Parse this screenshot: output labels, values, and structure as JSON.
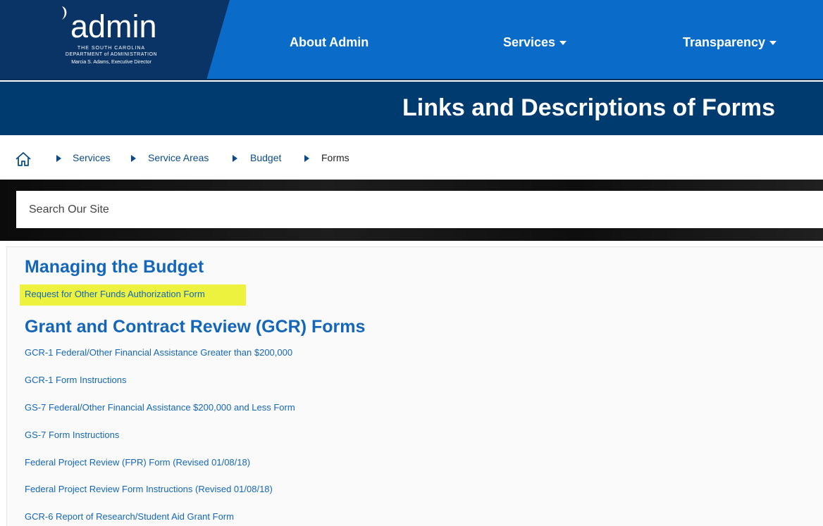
{
  "header": {
    "logo": {
      "word": "admin",
      "line1": "THE SOUTH CAROLINA",
      "line2": "DEPARTMENT of ADMINISTRATION",
      "line3": "Marcia S. Adams, Executive Director"
    },
    "nav": {
      "about": "About Admin",
      "services": "Services",
      "transparency": "Transparency"
    }
  },
  "page_title": "Links and Descriptions of Forms",
  "breadcrumb": [
    "Services",
    "Service Areas",
    "Budget",
    "Forms"
  ],
  "search": {
    "placeholder": "Search Our Site"
  },
  "sections": {
    "managing": {
      "title": "Managing the Budget",
      "links": [
        "Request for Other Funds Authorization Form"
      ]
    },
    "gcr": {
      "title": "Grant and Contract Review (GCR) Forms",
      "links": [
        "GCR-1 Federal/Other Financial Assistance Greater than $200,000",
        "GCR-1 Form Instructions",
        "GS-7 Federal/Other Financial Assistance $200,000 and Less Form",
        "GS-7 Form Instructions",
        "Federal Project Review (FPR) Form (Revised 01/08/18)",
        "Federal Project Review Form Instructions (Revised 01/08/18)",
        "GCR-6 Report of Research/Student Aid Grant Form"
      ]
    }
  },
  "colors": {
    "nav_blue": "#0a6bc9",
    "dark_navy": "#003b6f",
    "link_blue": "#1466b8",
    "highlight": "#ecf23d"
  }
}
